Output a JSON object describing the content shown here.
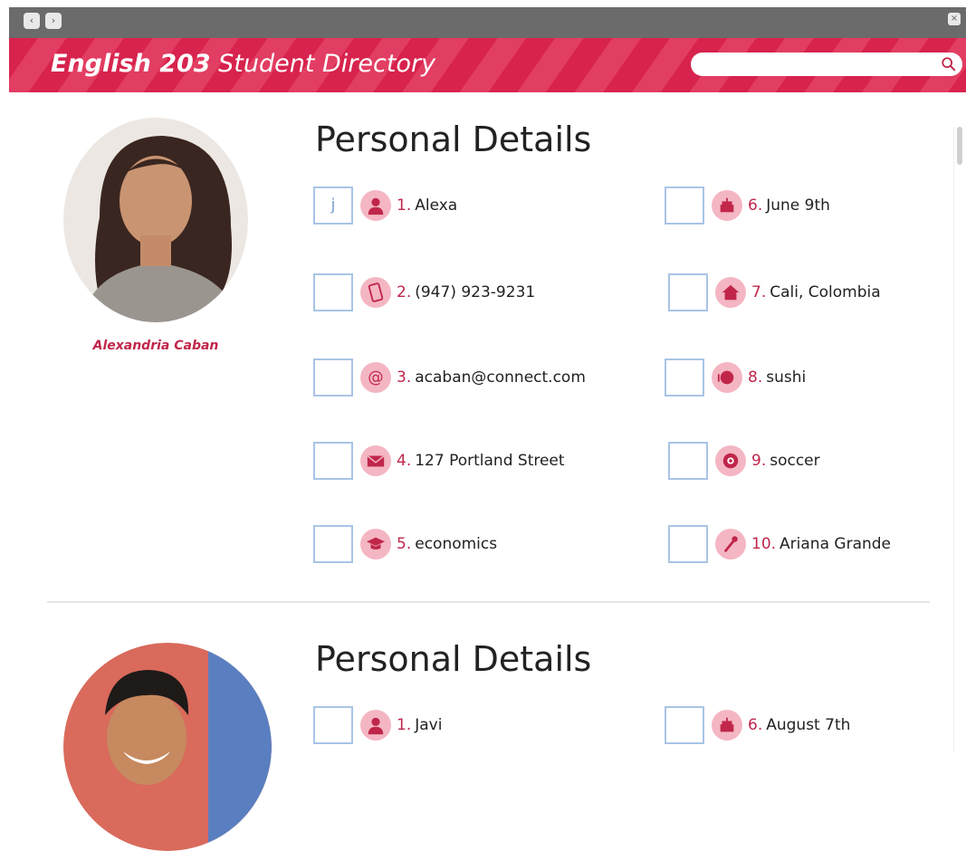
{
  "window": {
    "back_label": "‹",
    "forward_label": "›",
    "close_label": "×"
  },
  "header": {
    "title_bold": "English 203",
    "title_rest": " Student Directory"
  },
  "search": {
    "placeholder": "",
    "value": ""
  },
  "students": [
    {
      "name": "Alexandria Caban",
      "section_title": "Personal Details",
      "details": [
        {
          "num": "1.",
          "value": "Alexa",
          "icon": "person-icon",
          "check": "j"
        },
        {
          "num": "2.",
          "value": "(947) 923-9231",
          "icon": "phone-icon",
          "check": ""
        },
        {
          "num": "3.",
          "value": "acaban@connect.com",
          "icon": "at-icon",
          "check": ""
        },
        {
          "num": "4.",
          "value": "127 Portland Street",
          "icon": "envelope-icon",
          "check": ""
        },
        {
          "num": "5.",
          "value": "economics",
          "icon": "graduation-cap-icon",
          "check": ""
        },
        {
          "num": "6.",
          "value": "June 9th",
          "icon": "birthday-cake-icon",
          "check": ""
        },
        {
          "num": "7.",
          "value": "Cali, Colombia",
          "icon": "home-icon",
          "check": ""
        },
        {
          "num": "8.",
          "value": "sushi",
          "icon": "food-icon",
          "check": ""
        },
        {
          "num": "9.",
          "value": "soccer",
          "icon": "soccer-ball-icon",
          "check": ""
        },
        {
          "num": "10.",
          "value": "Ariana Grande",
          "icon": "microphone-icon",
          "check": ""
        }
      ]
    },
    {
      "name": "",
      "section_title": "Personal Details",
      "details": [
        {
          "num": "1.",
          "value": "Javi",
          "icon": "person-icon",
          "check": ""
        },
        {
          "num": "6.",
          "value": "August 7th",
          "icon": "birthday-cake-icon",
          "check": ""
        }
      ]
    }
  ],
  "colors": {
    "accent": "#d7234d",
    "icon_bg": "#f4b6c3",
    "checkbox_border": "#a9c4e6"
  }
}
